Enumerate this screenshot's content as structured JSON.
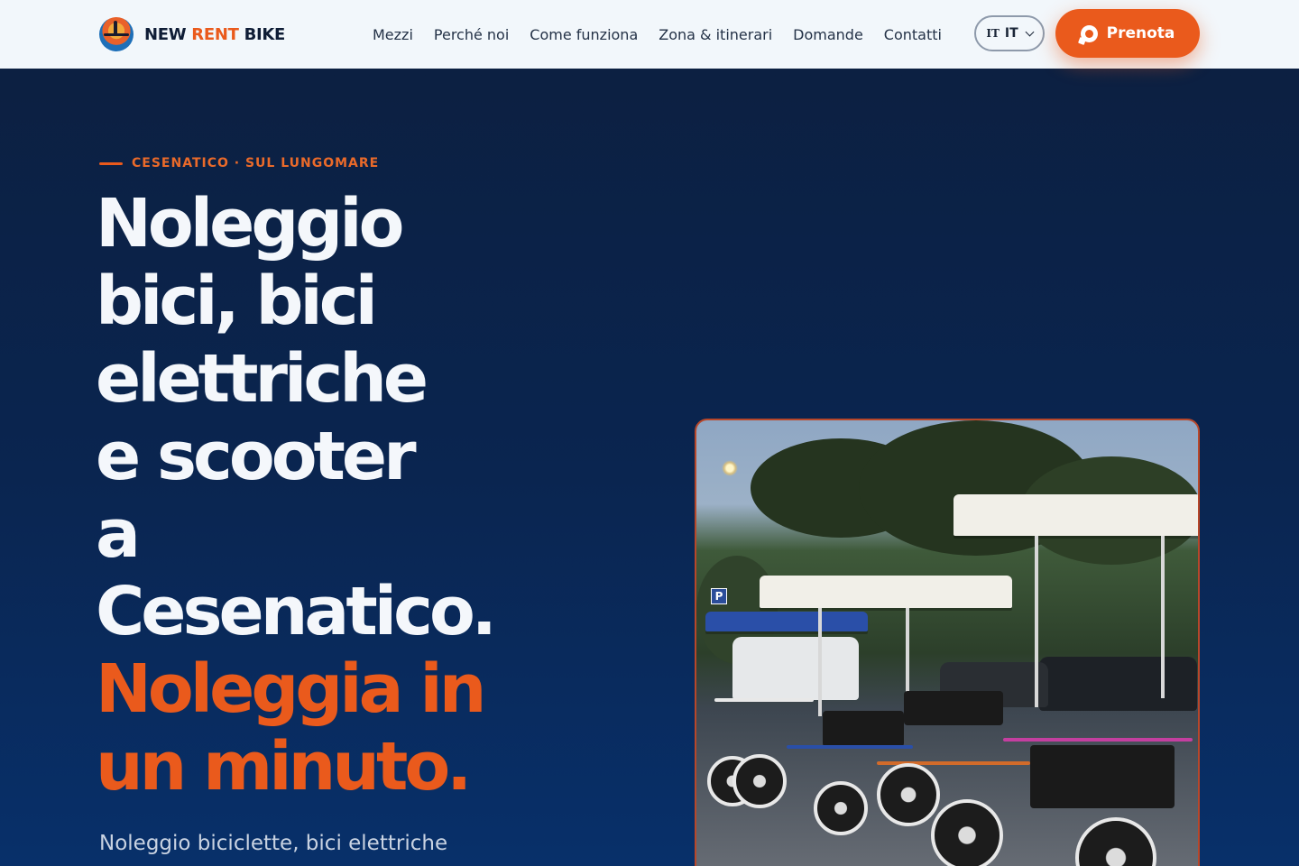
{
  "brand": {
    "name_part1": "NEW",
    "name_part2": "RENT",
    "name_part3": "BIKE",
    "logo_icon": "palm-sunset-logo"
  },
  "nav": {
    "items": [
      "Mezzi",
      "Perché noi",
      "Come funziona",
      "Zona & itinerari",
      "Domande",
      "Contatti"
    ]
  },
  "language": {
    "flag": "IT",
    "code": "IT"
  },
  "cta": {
    "label": "Prenota",
    "icon": "whatsapp-icon"
  },
  "hero": {
    "eyebrow": "CESENATICO · SUL LUNGOMARE",
    "headline_lines": [
      "Noleggio",
      "bici, bici",
      "elettriche",
      "e scooter",
      "a",
      "Cesenatico."
    ],
    "headline_accent_lines": [
      "Noleggia in",
      "un minuto."
    ],
    "subtitle": "Noleggio biciclette, bici elettriche",
    "photo_sign": "P"
  },
  "colors": {
    "accent": "#ea5a1c",
    "header_bg": "#f2f7fb",
    "hero_bg": "#0a2550",
    "text_light": "#f4f7fb"
  }
}
